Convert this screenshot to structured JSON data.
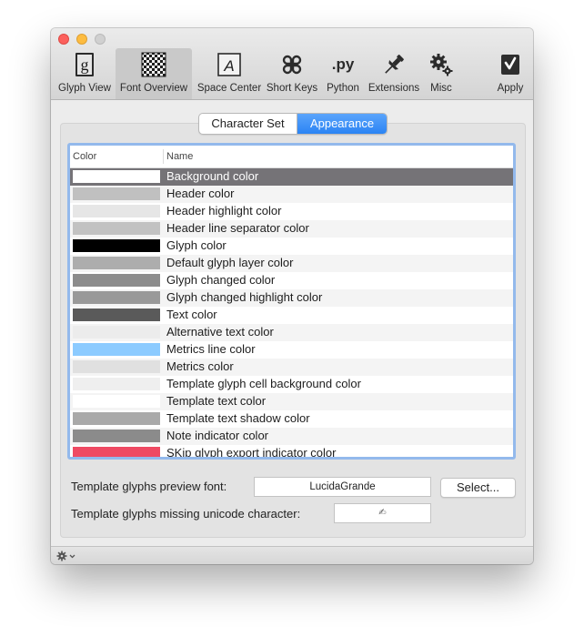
{
  "toolbar": {
    "items": [
      {
        "label": "Glyph View",
        "icon": "glyph-view-icon"
      },
      {
        "label": "Font Overview",
        "icon": "font-overview-icon"
      },
      {
        "label": "Space Center",
        "icon": "space-center-icon"
      },
      {
        "label": "Short Keys",
        "icon": "command-key-icon"
      },
      {
        "label": "Python",
        "icon": "python-icon"
      },
      {
        "label": "Extensions",
        "icon": "pin-icon"
      },
      {
        "label": "Misc",
        "icon": "gears-icon"
      },
      {
        "label": "Apply",
        "icon": "apply-icon"
      }
    ],
    "active": "Font Overview",
    "glyph_view_glyph": "g",
    "space_center_glyph": "A",
    "python_glyph": ".py"
  },
  "tabs": [
    {
      "label": "Character Set",
      "selected": false
    },
    {
      "label": "Appearance",
      "selected": true
    }
  ],
  "table": {
    "headers": [
      "Color",
      "Name"
    ],
    "rows": [
      {
        "name": "Background color",
        "color": "#ffffff",
        "selected": true
      },
      {
        "name": "Header color",
        "color": "#c0c0c0"
      },
      {
        "name": "Header highlight color",
        "color": "#e6e6e6"
      },
      {
        "name": "Header line separator color",
        "color": "#c2c2c2"
      },
      {
        "name": "Glyph color",
        "color": "#000000"
      },
      {
        "name": "Default glyph layer color",
        "color": "#adadad"
      },
      {
        "name": "Glyph changed color",
        "color": "#8c8c8c"
      },
      {
        "name": "Glyph changed highlight color",
        "color": "#999999"
      },
      {
        "name": "Text color",
        "color": "#5a5a5a"
      },
      {
        "name": "Alternative text color",
        "color": "#ececec"
      },
      {
        "name": "Metrics line color",
        "color": "#8ccbff"
      },
      {
        "name": "Metrics color",
        "color": "#e0e0e0"
      },
      {
        "name": "Template glyph cell background color",
        "color": "#efefef"
      },
      {
        "name": "Template text color",
        "color": "#ffffff"
      },
      {
        "name": "Template text shadow color",
        "color": "#a9a9a9"
      },
      {
        "name": "Note indicator color",
        "color": "#8b8b8b"
      },
      {
        "name": "SKip glyph export indicator color",
        "color": "#ef4a63"
      }
    ]
  },
  "preview_font": {
    "label": "Template glyphs preview font:",
    "value": "LucidaGrande",
    "button": "Select..."
  },
  "missing_char": {
    "label": "Template glyphs missing unicode character:",
    "value": "✍"
  },
  "colors": {
    "accent": "#2b84f4",
    "selected_row": "#757377",
    "focus_ring": "#93b9ec"
  }
}
